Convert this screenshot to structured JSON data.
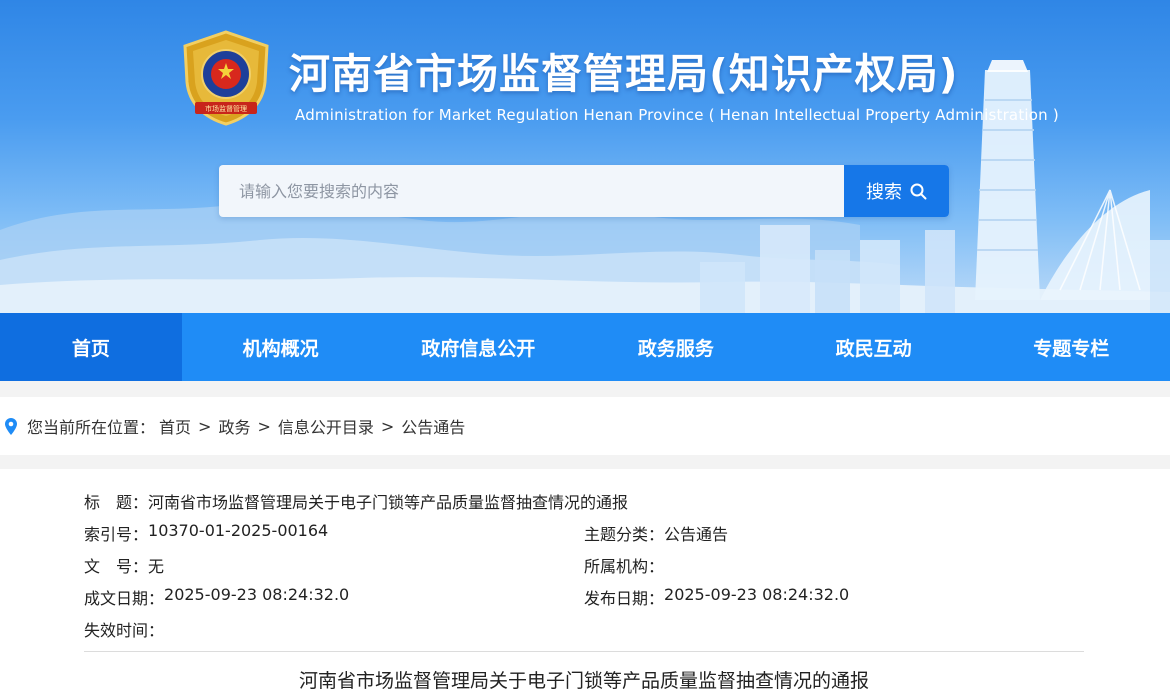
{
  "header": {
    "title": "河南省市场监督管理局(知识产权局)",
    "subtitle": "Administration for  Market Regulation Henan Province ( Henan Intellectual Property  Administration )",
    "emblem_text": "市场监督管理"
  },
  "search": {
    "placeholder": "请输入您要搜索的内容",
    "button_label": "搜索"
  },
  "nav": {
    "items": [
      {
        "label": "首页",
        "active": true
      },
      {
        "label": "机构概况"
      },
      {
        "label": "政府信息公开"
      },
      {
        "label": "政务服务"
      },
      {
        "label": "政民互动"
      },
      {
        "label": "专题专栏"
      }
    ]
  },
  "breadcrumb": {
    "prefix": "您当前所在位置：",
    "items": [
      "首页",
      "政务",
      "信息公开目录",
      "公告通告"
    ],
    "separator": ">"
  },
  "meta": {
    "title_label": "标　题：",
    "title_value": "河南省市场监督管理局关于电子门锁等产品质量监督抽查情况的通报",
    "index_label": "索引号：",
    "index_value": "10370-01-2025-00164",
    "topic_label": "主题分类：",
    "topic_value": "公告通告",
    "docno_label": "文　号：",
    "docno_value": "无",
    "org_label": "所属机构：",
    "org_value": "",
    "created_label": "成文日期：",
    "created_value": "2025-09-23 08:24:32.0",
    "published_label": "发布日期：",
    "published_value": "2025-09-23 08:24:32.0",
    "expire_label": "失效时间：",
    "expire_value": ""
  },
  "article": {
    "title": "河南省市场监督管理局关于电子门锁等产品质量监督抽查情况的通报"
  },
  "colors": {
    "nav_bg": "#1f8cf6",
    "nav_active": "#0f6ee0",
    "search_button": "#1677e8",
    "banner_top": "#2f86e6"
  }
}
